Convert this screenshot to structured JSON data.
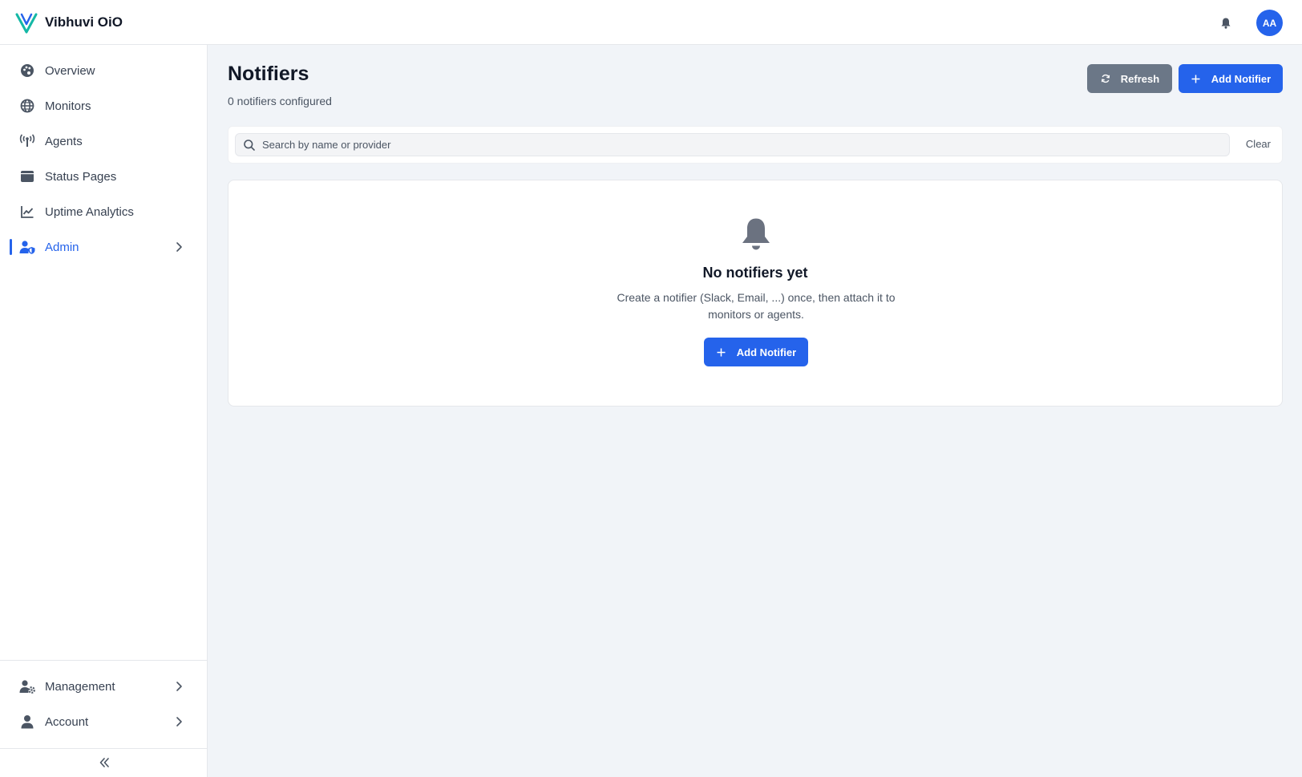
{
  "app": {
    "name": "Vibhuvi OiO",
    "user_initials": "AA",
    "brand_color": "#2563eb"
  },
  "sidebar": {
    "items": [
      {
        "label": "Overview",
        "icon": "palette-icon"
      },
      {
        "label": "Monitors",
        "icon": "globe-icon"
      },
      {
        "label": "Agents",
        "icon": "antenna-icon"
      },
      {
        "label": "Status Pages",
        "icon": "window-icon"
      },
      {
        "label": "Uptime Analytics",
        "icon": "line-chart-icon"
      },
      {
        "label": "Admin",
        "icon": "user-shield-icon",
        "active": true,
        "has_children": true
      }
    ],
    "bottom_items": [
      {
        "label": "Management",
        "icon": "users-cog-icon",
        "has_children": true
      },
      {
        "label": "Account",
        "icon": "user-icon",
        "has_children": true
      }
    ],
    "collapse_icon": "double-chevron-left-icon"
  },
  "page": {
    "title": "Notifiers",
    "subtitle": "0 notifiers configured",
    "refresh_label": "Refresh",
    "add_label": "Add Notifier"
  },
  "search": {
    "placeholder": "Search by name or provider",
    "value": "",
    "clear_label": "Clear"
  },
  "empty_state": {
    "icon": "bell-icon",
    "title": "No notifiers yet",
    "description": "Create a notifier (Slack, Email, ...) once, then attach it to monitors or agents.",
    "button_label": "Add Notifier"
  }
}
